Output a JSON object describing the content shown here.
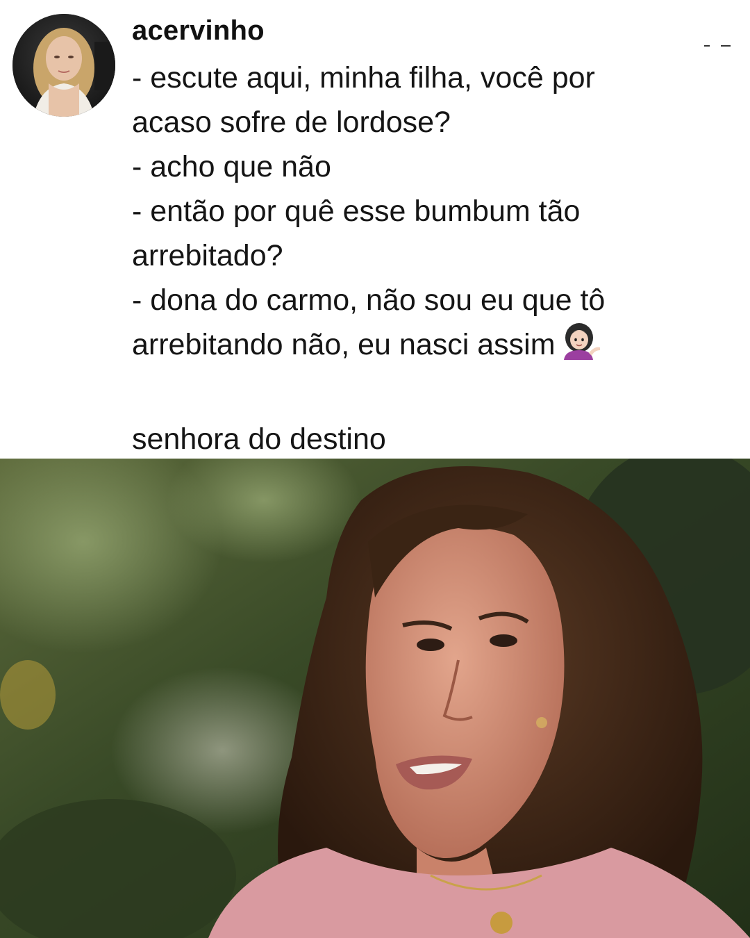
{
  "post": {
    "username": "acervinho",
    "text_lines": [
      "- escute aqui, minha filha, você por",
      "acaso sofre de lordose?",
      "- acho que não",
      "- então por quê esse bumbum tão",
      "arrebitado?",
      "- dona do carmo, não sou eu que tô",
      "arrebitando não, eu nasci assim"
    ],
    "caption": "senhora do destino"
  },
  "icons": {
    "emoji": "woman-tipping-hand-emoji",
    "menu": "more-options-icon"
  },
  "colors": {
    "background": "#ffffff",
    "text": "#151515",
    "emoji_shirt": "#9b3fa0"
  }
}
